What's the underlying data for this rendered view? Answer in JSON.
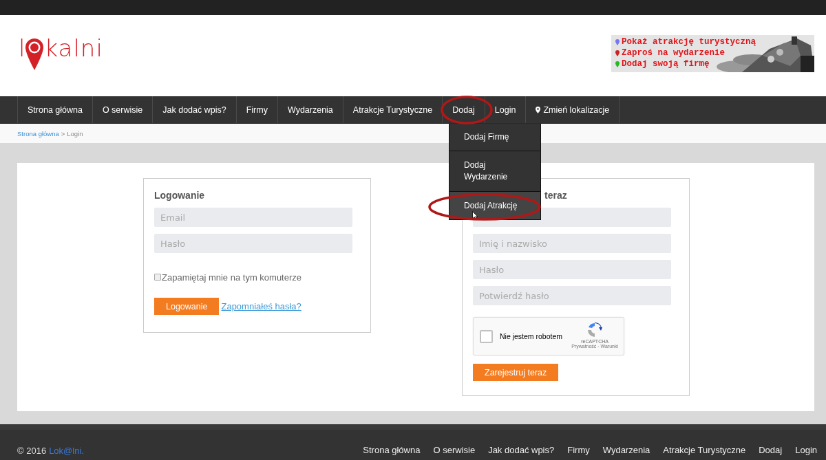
{
  "logo": {
    "before": "l",
    "after": "kalni"
  },
  "banner": {
    "lines": [
      {
        "text": "Pokaż atrakcję turystyczną",
        "color": "#7777ee"
      },
      {
        "text": "Zaproś na wydarzenie",
        "color": "#cc2222"
      },
      {
        "text": "Dodaj swoją firmę",
        "color": "#22bb22"
      }
    ]
  },
  "nav": [
    {
      "label": "Strona główna",
      "kind": "link"
    },
    {
      "label": "O serwisie",
      "kind": "link"
    },
    {
      "label": "Jak dodać wpis?",
      "kind": "link"
    },
    {
      "label": "Firmy",
      "kind": "link"
    },
    {
      "label": "Wydarzenia",
      "kind": "link"
    },
    {
      "label": "Atrakcje Turystyczne",
      "kind": "link"
    },
    {
      "label": "Dodaj",
      "kind": "link"
    },
    {
      "label": "Login",
      "kind": "link"
    },
    {
      "label": "Zmień lokalizacje",
      "kind": "location"
    }
  ],
  "dropdown": [
    {
      "label": "Dodaj Firmę",
      "selected": false
    },
    {
      "label": "Dodaj Wydarzenie",
      "selected": false
    },
    {
      "label": "Dodaj Atrakcję",
      "selected": true
    }
  ],
  "breadcrumb": {
    "link": "Strona główna",
    "separator": ">",
    "current": "Login"
  },
  "login": {
    "title": "Logowanie",
    "fields": [
      {
        "placeholder": "Email"
      },
      {
        "placeholder": "Hasło"
      }
    ],
    "remember": {
      "label": "Zapamiętaj mnie na tym komuterze",
      "checked": false
    },
    "button": "Logowanie",
    "forgot": "Zapomniałeś hasła?"
  },
  "register": {
    "title": "teraz",
    "fields": [
      {
        "kind": "input"
      },
      {
        "kind": "input",
        "placeholder": "Imię i nazwisko"
      },
      {
        "kind": "input",
        "placeholder": "Hasło"
      },
      {
        "kind": "input",
        "placeholder": "Potwierdź hasło"
      }
    ],
    "captcha": {
      "label": "Nie jestem robotem",
      "checked": false,
      "brand": "reCAPTCHA",
      "links": "Prywatność - Warunki"
    },
    "button": "Zarejestruj teraz"
  },
  "footer": {
    "copyright": "© 2016",
    "brand": "Lok@lni.",
    "links": [
      "Strona główna",
      "O serwisie",
      "Jak dodać wpis?",
      "Firmy",
      "Wydarzenia",
      "Atrakcje Turystyczne",
      "Dodaj",
      "Login"
    ]
  }
}
